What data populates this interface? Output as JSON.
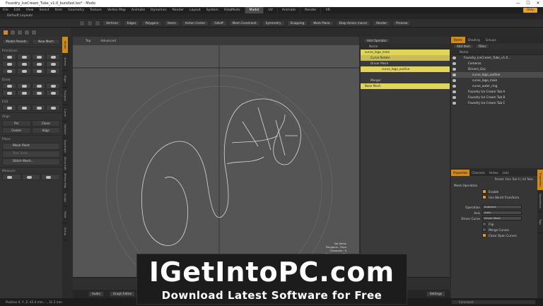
{
  "window": {
    "title": "Foundry_IceCream_Tube_v1.0_bundled.lxo* - Modo",
    "controls": [
      "—",
      "☐",
      "✕"
    ]
  },
  "menu": [
    "File",
    "Edit",
    "View",
    "Select",
    "Item",
    "Geometry",
    "Texture",
    "Vertex Map",
    "Animate",
    "Dynamics",
    "Render",
    "Layout",
    "System",
    "Help"
  ],
  "mode_tabs": [
    {
      "label": "Mode",
      "active": false
    },
    {
      "label": "Model",
      "active": true
    },
    {
      "label": "UV",
      "active": false
    },
    {
      "label": "Animate",
      "active": false
    },
    {
      "label": "Render",
      "active": false
    },
    {
      "label": "VR",
      "active": false
    }
  ],
  "only_button": "Only",
  "layout_name": "Default Layouts",
  "toolbar": [
    "Vertices",
    "Edges",
    "Polygons",
    "Items",
    "Action Center",
    "Falloff",
    "Mesh Constraint",
    "Symmetry",
    "Snapping",
    "Work Plane",
    "Drop Action (none)",
    "Render",
    "Preview"
  ],
  "left_panel": {
    "top_buttons": [
      "Model Presets",
      "New Mesh"
    ],
    "sections": {
      "primitives": "Primitives",
      "draw": "Draw",
      "edit": "Edit",
      "align": "Align",
      "place": "Place",
      "measure": "Measure"
    },
    "align_buttons": [
      "Pin",
      "Clone",
      "Center",
      "Align"
    ],
    "place_buttons": [
      {
        "label": "Mesh Paint",
        "dim": false
      },
      {
        "label": "Test Tools",
        "dim": true
      },
      {
        "label": "Stitch Mesh...",
        "dim": false
      }
    ],
    "vertical_tabs": [
      {
        "label": "Model",
        "active": true
      },
      {
        "label": "Vertex",
        "active": false
      },
      {
        "label": "Edge",
        "active": false
      },
      {
        "label": "Polygon",
        "active": false
      },
      {
        "label": "Curve",
        "active": false
      },
      {
        "label": "Deform",
        "active": false
      },
      {
        "label": "Duplicate",
        "active": false
      },
      {
        "label": "Mesh Edit",
        "active": false
      },
      {
        "label": "Vertex Map",
        "active": false
      },
      {
        "label": "Sculpt",
        "active": false
      },
      {
        "label": "Paint",
        "active": false
      },
      {
        "label": "Setup",
        "active": false
      }
    ]
  },
  "viewport": {
    "view_name": "Top",
    "shading": "Advanced",
    "overlay_lines": [
      "No Items",
      "Polygons : Face",
      "Channels : 0",
      "Deformers : ON"
    ]
  },
  "scene_panel": {
    "add_operator": "Add Operator",
    "column_header": "Name",
    "rows": [
      {
        "label": "curve_logo_main",
        "style": "y",
        "indent": 0
      },
      {
        "label": "Curve Rotate",
        "style": "yd",
        "indent": 1
      },
      {
        "label": "Driver Mesh",
        "style": "g",
        "indent": 1
      },
      {
        "label": "curve_logo_outline",
        "style": "y",
        "indent": 2
      },
      {
        "label": "",
        "style": "g",
        "indent": 2
      },
      {
        "label": "Merger",
        "style": "g",
        "indent": 1
      },
      {
        "label": "Base Mesh",
        "style": "y",
        "indent": 0
      }
    ]
  },
  "item_list": {
    "tabs": [
      {
        "label": "Items",
        "active": true
      },
      {
        "label": "Shading",
        "active": false
      },
      {
        "label": "Groups",
        "active": false
      }
    ],
    "buttons": [
      "Add Item",
      "Filter"
    ],
    "column_header": "Name",
    "rows": [
      {
        "label": "Foundry_IceCream_Tube_v1.0...",
        "indent": 0,
        "hl": false
      },
      {
        "label": "Cameras",
        "indent": 1,
        "hl": false
      },
      {
        "label": "Drivers_Grp",
        "indent": 1,
        "hl": false
      },
      {
        "label": "curve_logo_outline",
        "indent": 2,
        "hl": true
      },
      {
        "label": "curve_logo_main",
        "indent": 2,
        "hl": false
      },
      {
        "label": "curve_outer_ring",
        "indent": 2,
        "hl": false
      },
      {
        "label": "Foundry Ice Cream Tub A",
        "indent": 1,
        "hl": false
      },
      {
        "label": "Foundry Ice Cream Tub B",
        "indent": 1,
        "hl": false
      },
      {
        "label": "Foundry Ice Cream Tub C",
        "indent": 1,
        "hl": false
      }
    ]
  },
  "properties": {
    "tabs": [
      {
        "label": "Properties",
        "active": true
      },
      {
        "label": "Channels",
        "active": false
      },
      {
        "label": "Vertex",
        "active": false
      },
      {
        "label": "Lists",
        "active": false
      }
    ],
    "preset_line": "Preset: Ona Tub A  |  All Tabs",
    "section": "Mesh Operation",
    "checkboxes": [
      {
        "label": "Enable",
        "checked": true
      },
      {
        "label": "Use World Transform",
        "checked": true
      }
    ],
    "fields": [
      {
        "label": "Operation",
        "value": "Subtract"
      },
      {
        "label": "Axis",
        "value": "Auto"
      },
      {
        "label": "Driver Curve",
        "value": "Driver Mesh"
      }
    ],
    "lower_checks": [
      {
        "label": "Flip",
        "checked": false
      },
      {
        "label": "Merge Curves",
        "checked": false
      },
      {
        "label": "Close Open Curves",
        "checked": true
      }
    ],
    "right_tabs": [
      {
        "label": "Properties",
        "active": true
      },
      {
        "label": "Mesh Operations",
        "active": false
      },
      {
        "label": "Tags",
        "active": false
      }
    ]
  },
  "bottom_bar": [
    "Audio",
    "Graph Editor",
    "Settings"
  ],
  "status": "Position X, Y, Z:   42.4 mm,  -  , 31.3 mm",
  "command": "Command",
  "banner": {
    "title": "IGetIntoPC.com",
    "subtitle": "Download Latest Software for Free"
  }
}
